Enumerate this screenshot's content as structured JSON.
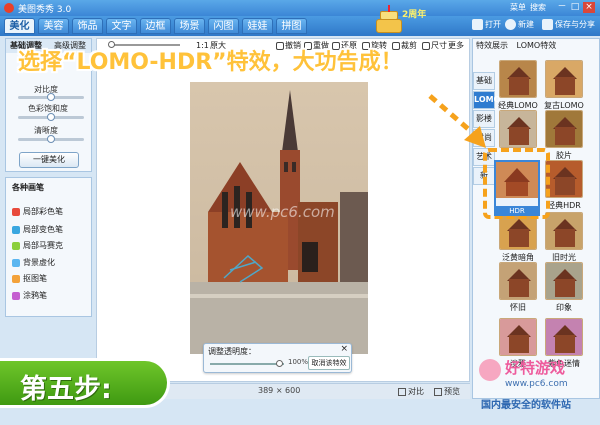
{
  "app": {
    "title": "美图秀秀 3.0",
    "menu": [
      "菜单",
      "搜索",
      "—"
    ],
    "window_controls": [
      "－",
      "□",
      "×"
    ],
    "anniversary": "2周年"
  },
  "tabs": [
    "美化",
    "美容",
    "饰品",
    "文字",
    "边框",
    "场景",
    "闪图",
    "娃娃",
    "拼图"
  ],
  "active_tab": "美化",
  "toolbar": {
    "open": "打开",
    "new": "新建",
    "save_share": "保存与分享"
  },
  "left_panel": {
    "tabs": [
      "基础调整",
      "高级调整"
    ],
    "sliders": [
      {
        "label": "对比度",
        "value": 0.5
      },
      {
        "label": "色彩饱和度",
        "value": 0.5
      },
      {
        "label": "清晰度",
        "value": 0.5
      }
    ],
    "one_key_button": "一键美化"
  },
  "brush_panel": {
    "title": "各种画笔",
    "items": [
      "局部彩色笔",
      "局部变色笔",
      "局部马赛克",
      "背景虚化",
      "抠图笔",
      "涂鸦笔"
    ],
    "icon_colors": [
      "#e84a3c",
      "#3aa7e0",
      "#8ccf3c",
      "#5bb6f0",
      "#f3a23a",
      "#c45fd0"
    ]
  },
  "edit_tools": {
    "ratio": "1:1",
    "original": "原大",
    "undo": "撤销",
    "redo": "重做",
    "reset": "还原",
    "rotate": "旋转",
    "crop": "裁剪",
    "resize": "尺寸",
    "more": "更多"
  },
  "status": {
    "dimensions": "389 × 600",
    "compare": "对比",
    "preview": "预览"
  },
  "opacity_panel": {
    "title": "调整透明度：",
    "value_percent": 100,
    "value_text": "100%",
    "cancel": "取消该特效"
  },
  "effects_panel": {
    "tabs": [
      "特效展示",
      "LOMO特效"
    ],
    "categories": [
      "基础",
      "LOMO",
      "影楼",
      "时尚",
      "艺术",
      "新"
    ],
    "active_category": "LOMO",
    "thumbnails": [
      {
        "label": "经典LOMO",
        "tone": "#b8864a"
      },
      {
        "label": "复古LOMO",
        "tone": "#d9a866"
      },
      {
        "label": "",
        "tone": "#c7b59a"
      },
      {
        "label": "胶片",
        "tone": "#a0783a"
      },
      {
        "label": "HDR",
        "tone": "#c77a45"
      },
      {
        "label": "经典HDR",
        "tone": "#b65c2c"
      },
      {
        "label": "泛黄暗角",
        "tone": "#d8a24f"
      },
      {
        "label": "旧时光",
        "tone": "#c8a36a"
      },
      {
        "label": "怀旧",
        "tone": "#c4a276"
      },
      {
        "label": "印象",
        "tone": "#a9a38c"
      },
      {
        "label": "淡雅",
        "tone": "#d89a9a"
      },
      {
        "label": "紫色迷情",
        "tone": "#c482b0"
      }
    ]
  },
  "headline": "选择“LOMO-HDR”特效，大功告成！",
  "step_badge": "第五步:",
  "watermark": "www.pc6.com",
  "branding": {
    "name": "好特游戏",
    "url": "www.pc6.com",
    "slogan": "国内最安全的软件站"
  },
  "colors": {
    "accent": "#3a86d8",
    "headline": "#ffc23a",
    "step_green": "#4ea61a",
    "highlight_orange": "#f6a21c"
  }
}
